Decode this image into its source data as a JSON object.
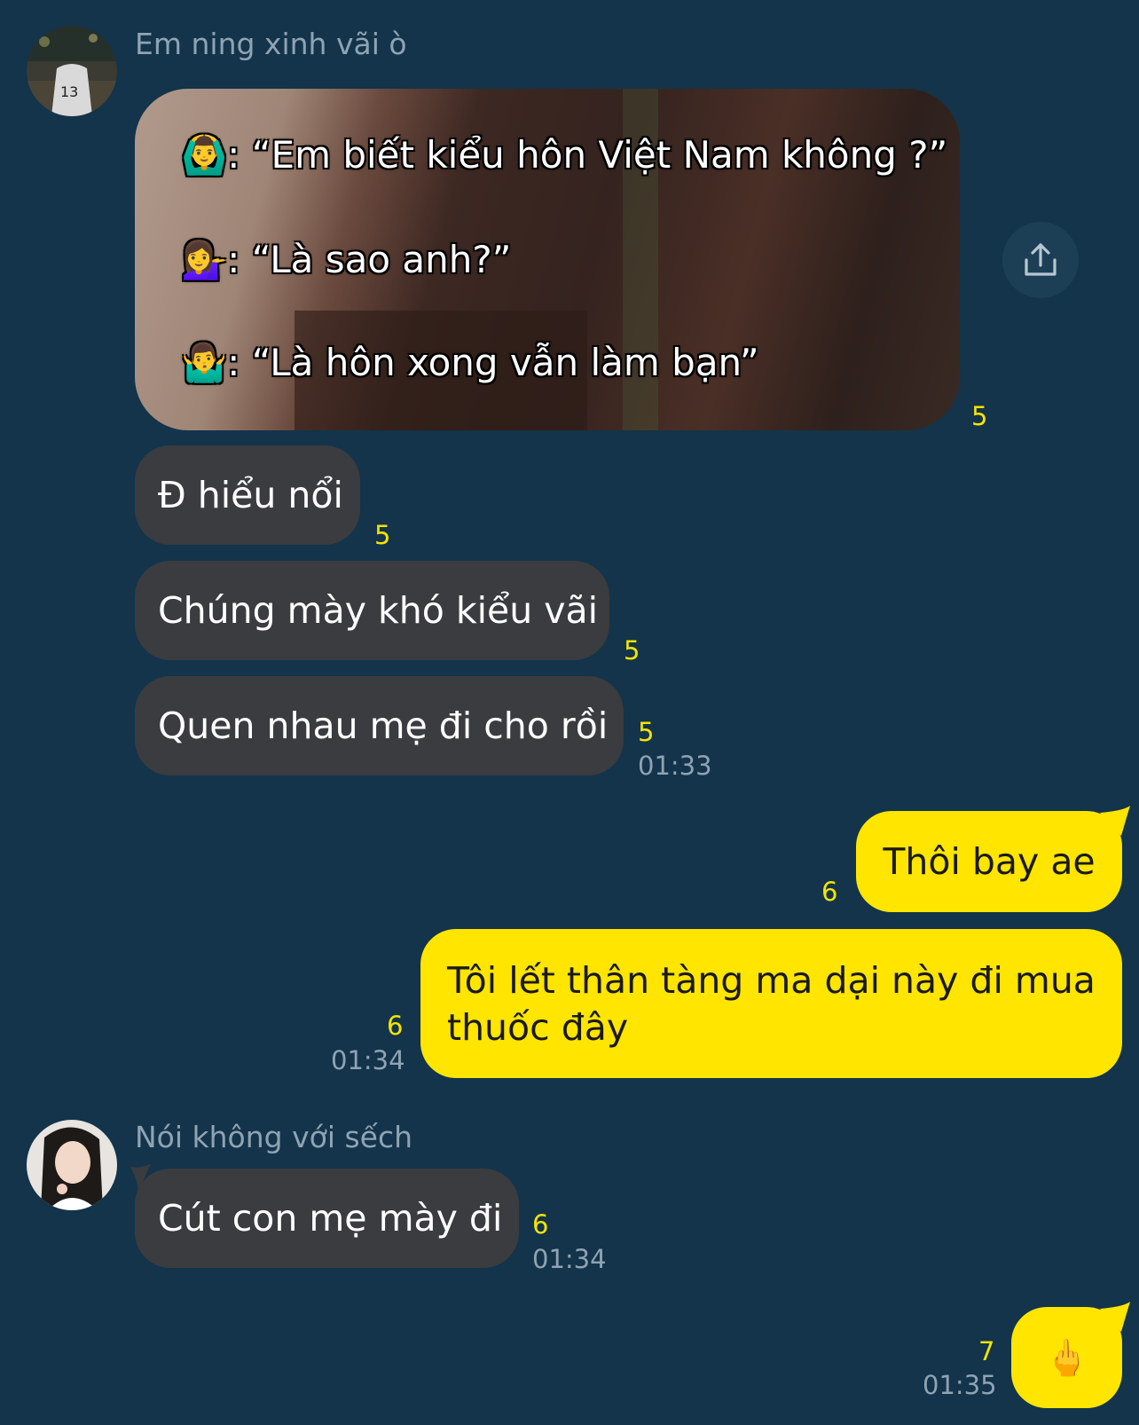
{
  "messages": [
    {
      "sender": "Em ning xinh vãi ò",
      "image_text": {
        "line1": ": “Em biết kiểu hôn Việt Nam không ?”",
        "line2": ": “Là sao anh?”",
        "line3": ": “Là hôn xong vẫn làm bạn”",
        "emoji1": "🙆‍♂️",
        "emoji2": "💁‍♀️",
        "emoji3": "🤷‍♂️"
      },
      "image_unread": "5",
      "bubbles": [
        {
          "text": "Đ hiểu nổi",
          "unread": "5"
        },
        {
          "text": "Chúng mày khó kiểu vãi",
          "unread": "5"
        },
        {
          "text": "Quen nhau mẹ đi cho rồi",
          "unread": "5",
          "time": "01:33"
        }
      ]
    },
    {
      "outgoing": [
        {
          "text": "Thôi bay ae",
          "unread": "6"
        },
        {
          "line1": "Tôi lết thân tàng ma dại này đi mua",
          "line2": "thuốc đây",
          "unread": "6",
          "time": "01:34"
        }
      ]
    },
    {
      "sender": "Nói không với sếch",
      "bubble": {
        "text": "Cút con mẹ mày đi",
        "unread": "6",
        "time": "01:34"
      }
    },
    {
      "outgoing_emoji": {
        "text": "🖕",
        "unread": "7",
        "time": "01:35"
      }
    }
  ],
  "icons": {
    "share": "share-icon"
  }
}
